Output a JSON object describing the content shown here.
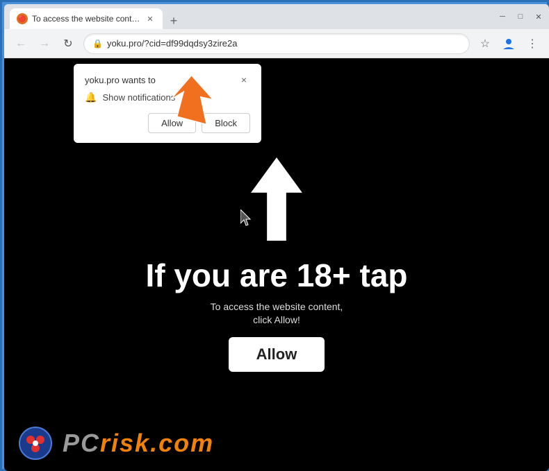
{
  "window": {
    "border_color": "#4a90d9"
  },
  "titlebar": {
    "tab_title": "To access the website content, cl",
    "tab_favicon": "🔴",
    "new_tab_label": "+",
    "controls": {
      "minimize": "─",
      "maximize": "□",
      "close": "✕"
    }
  },
  "addressbar": {
    "back_btn": "←",
    "forward_btn": "→",
    "refresh_btn": "↺",
    "url": "yoku.pro/?cid=df99dqdsy3zire2a",
    "lock_icon": "🔒",
    "star_icon": "☆",
    "profile_icon": "👤",
    "menu_icon": "⋮"
  },
  "notification_popup": {
    "site_name": "yoku.pro wants to",
    "close_btn": "×",
    "notification_text": "Show notifications",
    "allow_btn": "Allow",
    "block_btn": "Block"
  },
  "page": {
    "main_text": "If you are 18+ tap",
    "sub_text": "To access the website content, click Allow!",
    "allow_btn": "Allow"
  },
  "pcrisk": {
    "text_gray": "PC",
    "text_orange": "risk.com"
  }
}
